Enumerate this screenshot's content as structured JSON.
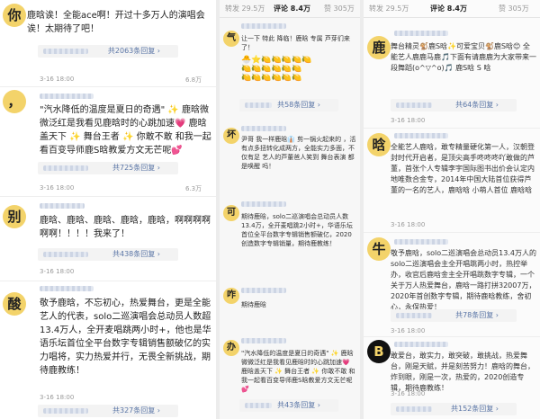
{
  "left": {
    "comments": [
      {
        "avatar": "你",
        "text": "鹿晗诶！全能ace啊！开过十多万人的演唱会诶！太期待了吧！",
        "time": "3-16 18:00",
        "likes": "6.8万",
        "reply": "共2063条回复 ›"
      },
      {
        "avatar": "，",
        "text": "\"汽水降低的温度是夏日的奇遇\" ✨ 鹿晗微微泛红是我看见鹿晗时的心跳加速💗 鹿晗盖天下 ✨ 舞台王者 ✨ 你敢不敢 和我一起看百变导师鹿S晗教爱方文无芒呢💕",
        "time": "3-16 18:00",
        "likes": "6.3万",
        "reply": "共725条回复 ›"
      },
      {
        "avatar": "别",
        "text": "鹿晗、鹿晗、鹿晗、鹿晗，鹿晗，啊啊啊啊啊啊！！！！我来了！",
        "time": "3-16 18:00",
        "likes": "",
        "reply": "共438条回复 ›"
      },
      {
        "avatar": "酸",
        "text": "敬予鹿晗，不忘初心，热爱舞台，更是全能艺人的代表，solo二巡演唱会总动员人数超13.4万人，全开麦唱跳两小时+，他也是华语乐坛首位全平台数字专辑销售额破亿的实力唱将，实力热爱并行，无畏全新挑战，期待鹿教练！",
        "time": "3-16 18:00",
        "likes": "",
        "reply": "共327条回复 ›"
      }
    ]
  },
  "middle": {
    "tabs": {
      "repost": "转发 29.5万",
      "comment": "评论 8.4万",
      "like": "赞 305万"
    },
    "comments": [
      {
        "avatar": "气",
        "text": "让一下 特此 降临！鹿晗 专属 芦芽们来了！",
        "reply": "共58条回复 ›"
      },
      {
        "avatar": "坏",
        "text": "尹哥 我一样鹿晗👔 剪一锅火起来的 ，活有点多扭转化成两方，全能实力多面，不仅有足 艺人的芦董爸人笑到 舞台表演 都是唤醒 吗！",
        "reply": ""
      },
      {
        "avatar": "可",
        "text": "期待鹿晗，solo二巡演唱会总动员人数13.4万，全开麦唱跳2小时+，华语乐坛首位全平台数字专辑销售额破亿，2020创造数字专辑销量，期待鹿教练！",
        "reply": ""
      },
      {
        "avatar": "咋",
        "text": "期待鹿晗",
        "reply": ""
      },
      {
        "avatar": "办",
        "text": "\"汽水降低的温度是夏日的奇遇\" ✨ 鹿晗微微泛红是我看见鹿晗时的心跳加速💗 鹿晗盖天下 ✨ 舞台王者 ✨ 你敢不敢 和我一起看百变导师鹿S晗教爱方文无芒呢💕",
        "reply": "共43条回复 ›"
      }
    ]
  },
  "right": {
    "tabs": {
      "repost": "转发 29.5万",
      "comment": "评论 8.4万",
      "like": "赞 305万"
    },
    "comments": [
      {
        "avatar": "鹿",
        "text": "舞台精灵🐒鹿S晗✨可爱宝贝🐒鹿S晗😊 全能艺人鹿鹿马鹿🎵下面有请鹿鹿为大家带来一段舞蹈(o^▽^o)🎵 鹿S晗 S 晗",
        "time": "3-16 18:00",
        "reply": "共64条回复 ›"
      },
      {
        "avatar": "晗",
        "text": "全能艺人鹿晗，敢专精量硬化第一人，汉朝登封时代开启者，是顶尖高手咚咚咚吖敢做的芦董，首张个人专辑李宇国际图书出价会认定内地唯数合金专，2014年中国大陆首位获得芦董的一名的艺人，鹿晗晗 小萌人首位 鹿晗晗",
        "time": "3-16 18:00",
        "reply": ""
      },
      {
        "avatar": "牛",
        "text": "敬予鹿晗，solo二巡演唱会总动员13.4万人的solo二巡演唱会主全开唱跳两小时，热控举办，收官后鹿晗金主全开唱跳数字专辑，一个关于万人热爱舞台，鹿晗一路打拼32007万，2020年首创数字专辑，期待鹿晗教练，舍初心，永保热爱！",
        "time": "3-16 18:00",
        "reply": "共78条回复 ›"
      },
      {
        "avatar": "B",
        "text": "敢爱台，敢实力，敢突破，敢挑战，热爱舞台，刚是天赋，并是刻苦努力！鹿晗的舞台，炸到眼，刚是一次，热爱的，2020创造专辑，期待鹿教练！",
        "time": "3-16 18:00",
        "reply": "共152条回复 ›"
      }
    ]
  },
  "colors": {
    "accent": "#f3d36a",
    "link": "#5a75a6"
  }
}
